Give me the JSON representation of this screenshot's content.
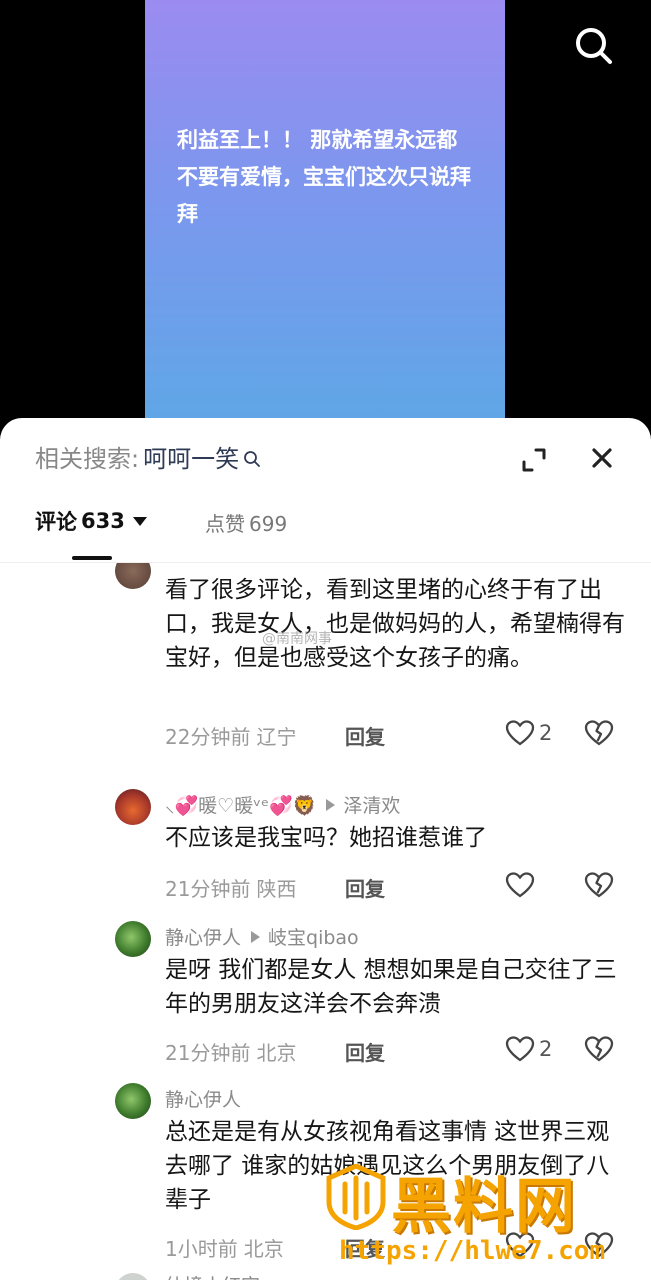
{
  "video": {
    "caption": "利益至上！！ 那就希望永远都不要有爱情，宝宝们这次只说拜拜",
    "gradient_top": "#9b8bf0",
    "gradient_bottom": "#5ea7e6"
  },
  "top_right": {
    "icon": "search-icon"
  },
  "sheet": {
    "related_label": "相关搜索:",
    "related_term": "呵呵一笑",
    "expand_icon": "expand-icon",
    "close_icon": "close-icon"
  },
  "tabs": {
    "comments_label": "评论",
    "comments_count": "633",
    "likes_label": "点赞",
    "likes_count": "699"
  },
  "comments": [
    {
      "text": "看了很多评论，看到这里堵的心终于有了出口，我是女人，也是做妈妈的人，希望楠得有宝好，但是也感受这个女孩子的痛。",
      "time": "22分钟前",
      "location": "辽宁",
      "reply_label": "回复",
      "likes": "2"
    },
    {
      "author": "⸜💞暖♡暖ᵛᵉ💞🦁",
      "reply_to": "泽清欢",
      "text": "不应该是我宝吗？她招谁惹谁了",
      "time": "21分钟前",
      "location": "陕西",
      "reply_label": "回复",
      "likes": ""
    },
    {
      "author": "静心伊人",
      "reply_to": "岐宝qibao",
      "text": "是呀 我们都是女人 想想如果是自己交往了三年的男朋友这洋会不会奔溃",
      "time": "21分钟前",
      "location": "北京",
      "reply_label": "回复",
      "likes": "2"
    },
    {
      "author": "静心伊人",
      "text": "总还是是有从女孩视角看这事情 这世界三观去哪了 谁家的姑娘遇见这么个男朋友倒了八辈子",
      "time": "1小时前",
      "location": "北京",
      "reply_label": "回复",
      "likes": ""
    },
    {
      "author": "仙境小红字"
    }
  ],
  "watermarks": {
    "weibo": "@南南网事",
    "logo_text": "黑料网",
    "logo_url": "https://hlwe7.com",
    "logo_color": "#f5a300"
  }
}
